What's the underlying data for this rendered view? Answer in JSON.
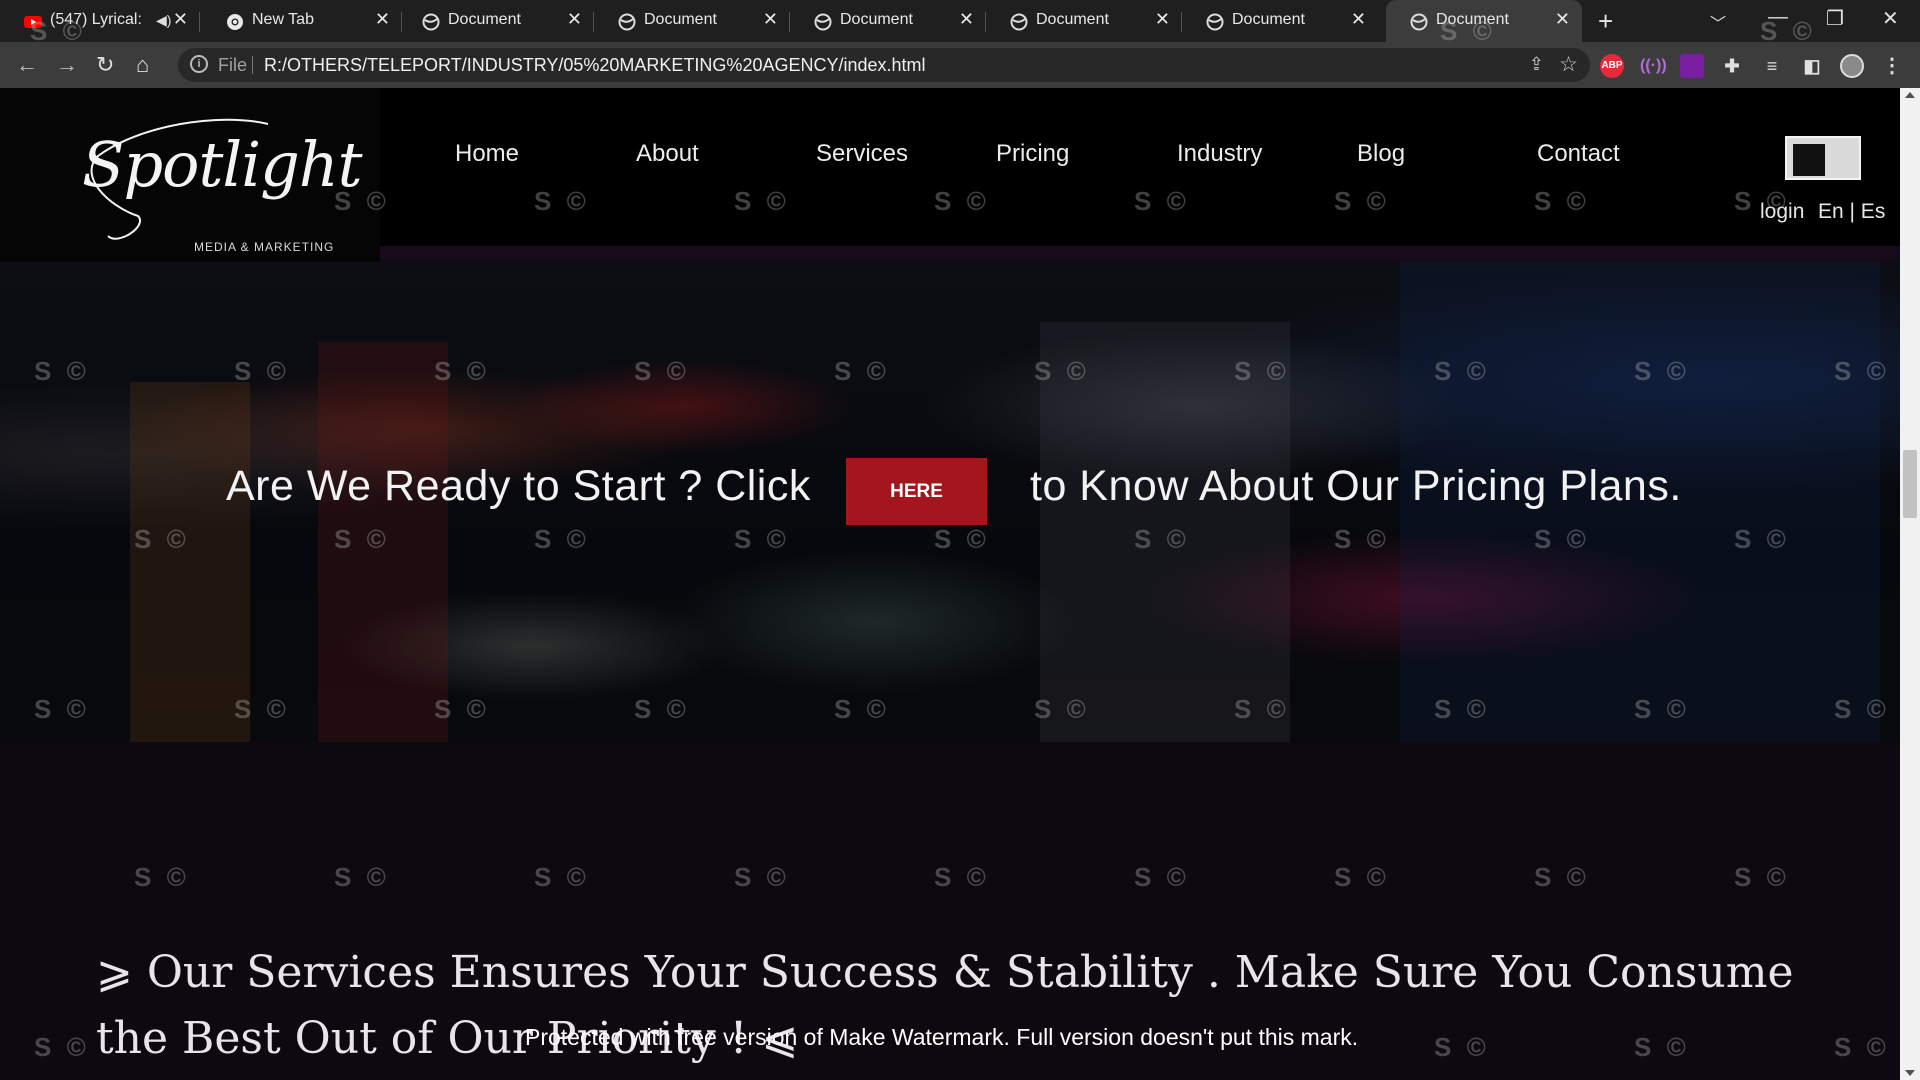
{
  "browser": {
    "tabs": [
      {
        "title": "(547) Lyrical:",
        "favicon": "youtube-icon"
      },
      {
        "title": "New Tab",
        "favicon": "chrome-icon"
      },
      {
        "title": "Document",
        "favicon": "globe-icon"
      },
      {
        "title": "Document",
        "favicon": "globe-icon"
      },
      {
        "title": "Document",
        "favicon": "globe-icon"
      },
      {
        "title": "Document",
        "favicon": "globe-icon"
      },
      {
        "title": "Document",
        "favicon": "globe-icon"
      },
      {
        "title": "Document",
        "favicon": "globe-icon",
        "active": true
      }
    ],
    "close_glyph": "✕",
    "new_tab_glyph": "+",
    "address_scheme": "File",
    "address_url": "R:/OTHERS/TELEPORT/INDUSTRY/05%20MARKETING%20AGENCY/index.html",
    "extensions": {
      "adblock": "ABP"
    },
    "accent_colors": {
      "youtube": "#ff0000",
      "adblock": "#e8283b",
      "ext_purple": "#7a1fa2"
    }
  },
  "site": {
    "logo_script": "Spotlight",
    "logo_tagline": "MEDIA & MARKETING",
    "nav": [
      "Home",
      "About",
      "Services",
      "Pricing",
      "Industry",
      "Blog",
      "Contact"
    ],
    "login": "login",
    "languages": "En | Es"
  },
  "hero": {
    "text_before": "Are We Ready to Start ? Click",
    "button_label": "HERE",
    "text_after": "to Know About Our Pricing Plans.",
    "button_color": "#a3161e"
  },
  "services": {
    "heading": "⩾ Our Services Ensures Your Success & Stability . Make Sure You Consume the Best Out of Our Priority ! ⩽"
  },
  "watermark": {
    "mark": "S ©",
    "banner": "Protected with free version of Make Watermark. Full version doesn't put this mark."
  }
}
